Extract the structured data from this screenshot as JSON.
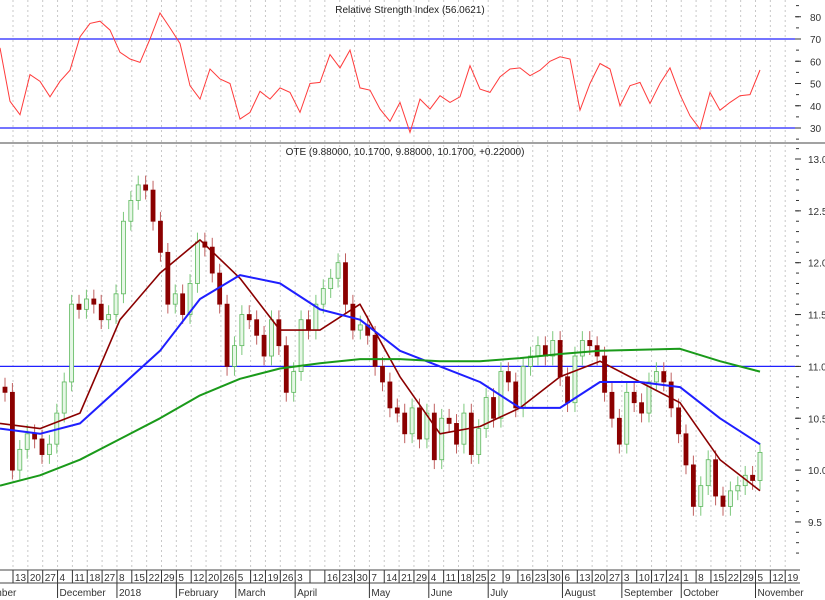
{
  "chart_data": [
    {
      "type": "line",
      "title": "Relative Strength Index (56.0621)",
      "ylim": [
        25,
        85
      ],
      "yticks": [
        "80",
        "70",
        "60",
        "50",
        "40",
        "30"
      ],
      "reference_lines": [
        70,
        30
      ],
      "series": [
        {
          "name": "RSI",
          "color": "#ff3b3b",
          "values": [
            66,
            42,
            36,
            54,
            51,
            44,
            51,
            56,
            71,
            77,
            78,
            74,
            64,
            61,
            59.5,
            70,
            81.7,
            75,
            68,
            49,
            43,
            56.5,
            52,
            50,
            34,
            37,
            46.5,
            43,
            48,
            46,
            37,
            50,
            50.5,
            63,
            57,
            65,
            48,
            47,
            38.5,
            33,
            41.5,
            28,
            43,
            38.5,
            44.5,
            41.5,
            44,
            58,
            47.5,
            46,
            53,
            56.5,
            57,
            53.5,
            56,
            60,
            62,
            61,
            38,
            50,
            59,
            56.5,
            40,
            49,
            50.5,
            41,
            50,
            57,
            45,
            35.5,
            29.5,
            46,
            38,
            41.5,
            44.5,
            45,
            56.06
          ]
        }
      ]
    },
    {
      "type": "candlestick",
      "title": "OTE (9.88000, 10.1700, 9.88000, 10.1700, +0.22000)",
      "ylim": [
        9.15,
        13.1
      ],
      "yticks": [
        "13.0",
        "12.5",
        "12.0",
        "11.5",
        "11.0",
        "10.5",
        "10.0",
        "9.5"
      ],
      "reference_line": 11.0,
      "close": [
        10.75,
        10.0,
        10.2,
        10.35,
        10.3,
        10.15,
        10.25,
        10.55,
        10.85,
        11.6,
        11.55,
        11.65,
        11.6,
        11.45,
        11.5,
        11.7,
        12.4,
        12.6,
        12.75,
        12.7,
        12.4,
        12.1,
        11.6,
        11.7,
        11.5,
        11.8,
        12.2,
        12.15,
        11.9,
        11.6,
        11.0,
        11.2,
        11.5,
        11.45,
        11.3,
        11.1,
        11.45,
        11.2,
        10.75,
        10.95,
        11.45,
        11.35,
        11.6,
        11.75,
        11.85,
        12.0,
        11.6,
        11.35,
        11.4,
        11.3,
        11.0,
        10.85,
        10.6,
        10.55,
        10.35,
        10.6,
        10.3,
        10.55,
        10.1,
        10.5,
        10.45,
        10.25,
        10.55,
        10.15,
        10.4,
        10.7,
        10.5,
        10.95,
        10.85,
        10.6,
        11.0,
        11.1,
        11.2,
        11.1,
        11.25,
        10.9,
        10.65,
        11.1,
        11.25,
        11.2,
        11.1,
        10.75,
        10.5,
        10.25,
        10.75,
        10.65,
        10.55,
        10.85,
        10.95,
        10.85,
        10.6,
        10.35,
        10.05,
        9.65,
        9.85,
        10.1,
        9.75,
        9.65,
        9.8,
        9.85,
        9.95,
        9.9,
        10.17
      ],
      "up_color": "#5cb85c",
      "down_color": "#8b0000",
      "moving_averages": [
        {
          "name": "short",
          "color": "#8b0000",
          "values": [
            10.45,
            10.4,
            10.55,
            11.45,
            11.9,
            12.22,
            11.85,
            11.35,
            11.35,
            11.6,
            10.9,
            10.35,
            10.42,
            10.6,
            10.9,
            11.05,
            10.85,
            10.65,
            10.1,
            9.8
          ]
        },
        {
          "name": "medium",
          "color": "#1f1fff",
          "values": [
            10.4,
            10.35,
            10.45,
            10.8,
            11.15,
            11.65,
            11.88,
            11.8,
            11.55,
            11.45,
            11.15,
            11.0,
            10.85,
            10.6,
            10.6,
            10.85,
            10.85,
            10.8,
            10.5,
            10.25
          ]
        },
        {
          "name": "long",
          "color": "#1a9a1a",
          "values": [
            9.85,
            9.95,
            10.1,
            10.3,
            10.5,
            10.72,
            10.88,
            10.98,
            11.03,
            11.07,
            11.07,
            11.05,
            11.05,
            11.08,
            11.12,
            11.15,
            11.16,
            11.17,
            11.05,
            10.95
          ]
        }
      ]
    }
  ],
  "x_axis": {
    "day_ticks": [
      "13",
      "20",
      "27",
      "4",
      "11",
      "18",
      "27",
      "8",
      "15",
      "22",
      "29",
      "5",
      "12",
      "20",
      "26",
      "5",
      "12",
      "19",
      "26",
      "3",
      "",
      "16",
      "23",
      "30",
      "7",
      "14",
      "21",
      "29",
      "4",
      "11",
      "18",
      "25",
      "2",
      "9",
      "16",
      "23",
      "30",
      "6",
      "13",
      "20",
      "27",
      "3",
      "10",
      "17",
      "24",
      "1",
      "8",
      "15",
      "22",
      "29",
      "5",
      "12",
      "19"
    ],
    "months": [
      {
        "label": "ember",
        "tick": -1
      },
      {
        "label": "December",
        "tick": 3
      },
      {
        "label": "2018",
        "tick": 7
      },
      {
        "label": "February",
        "tick": 11
      },
      {
        "label": "March",
        "tick": 15
      },
      {
        "label": "April",
        "tick": 19
      },
      {
        "label": "May",
        "tick": 24
      },
      {
        "label": "June",
        "tick": 28
      },
      {
        "label": "July",
        "tick": 32
      },
      {
        "label": "August",
        "tick": 37
      },
      {
        "label": "September",
        "tick": 41
      },
      {
        "label": "October",
        "tick": 45
      },
      {
        "label": "November",
        "tick": 50
      }
    ]
  }
}
